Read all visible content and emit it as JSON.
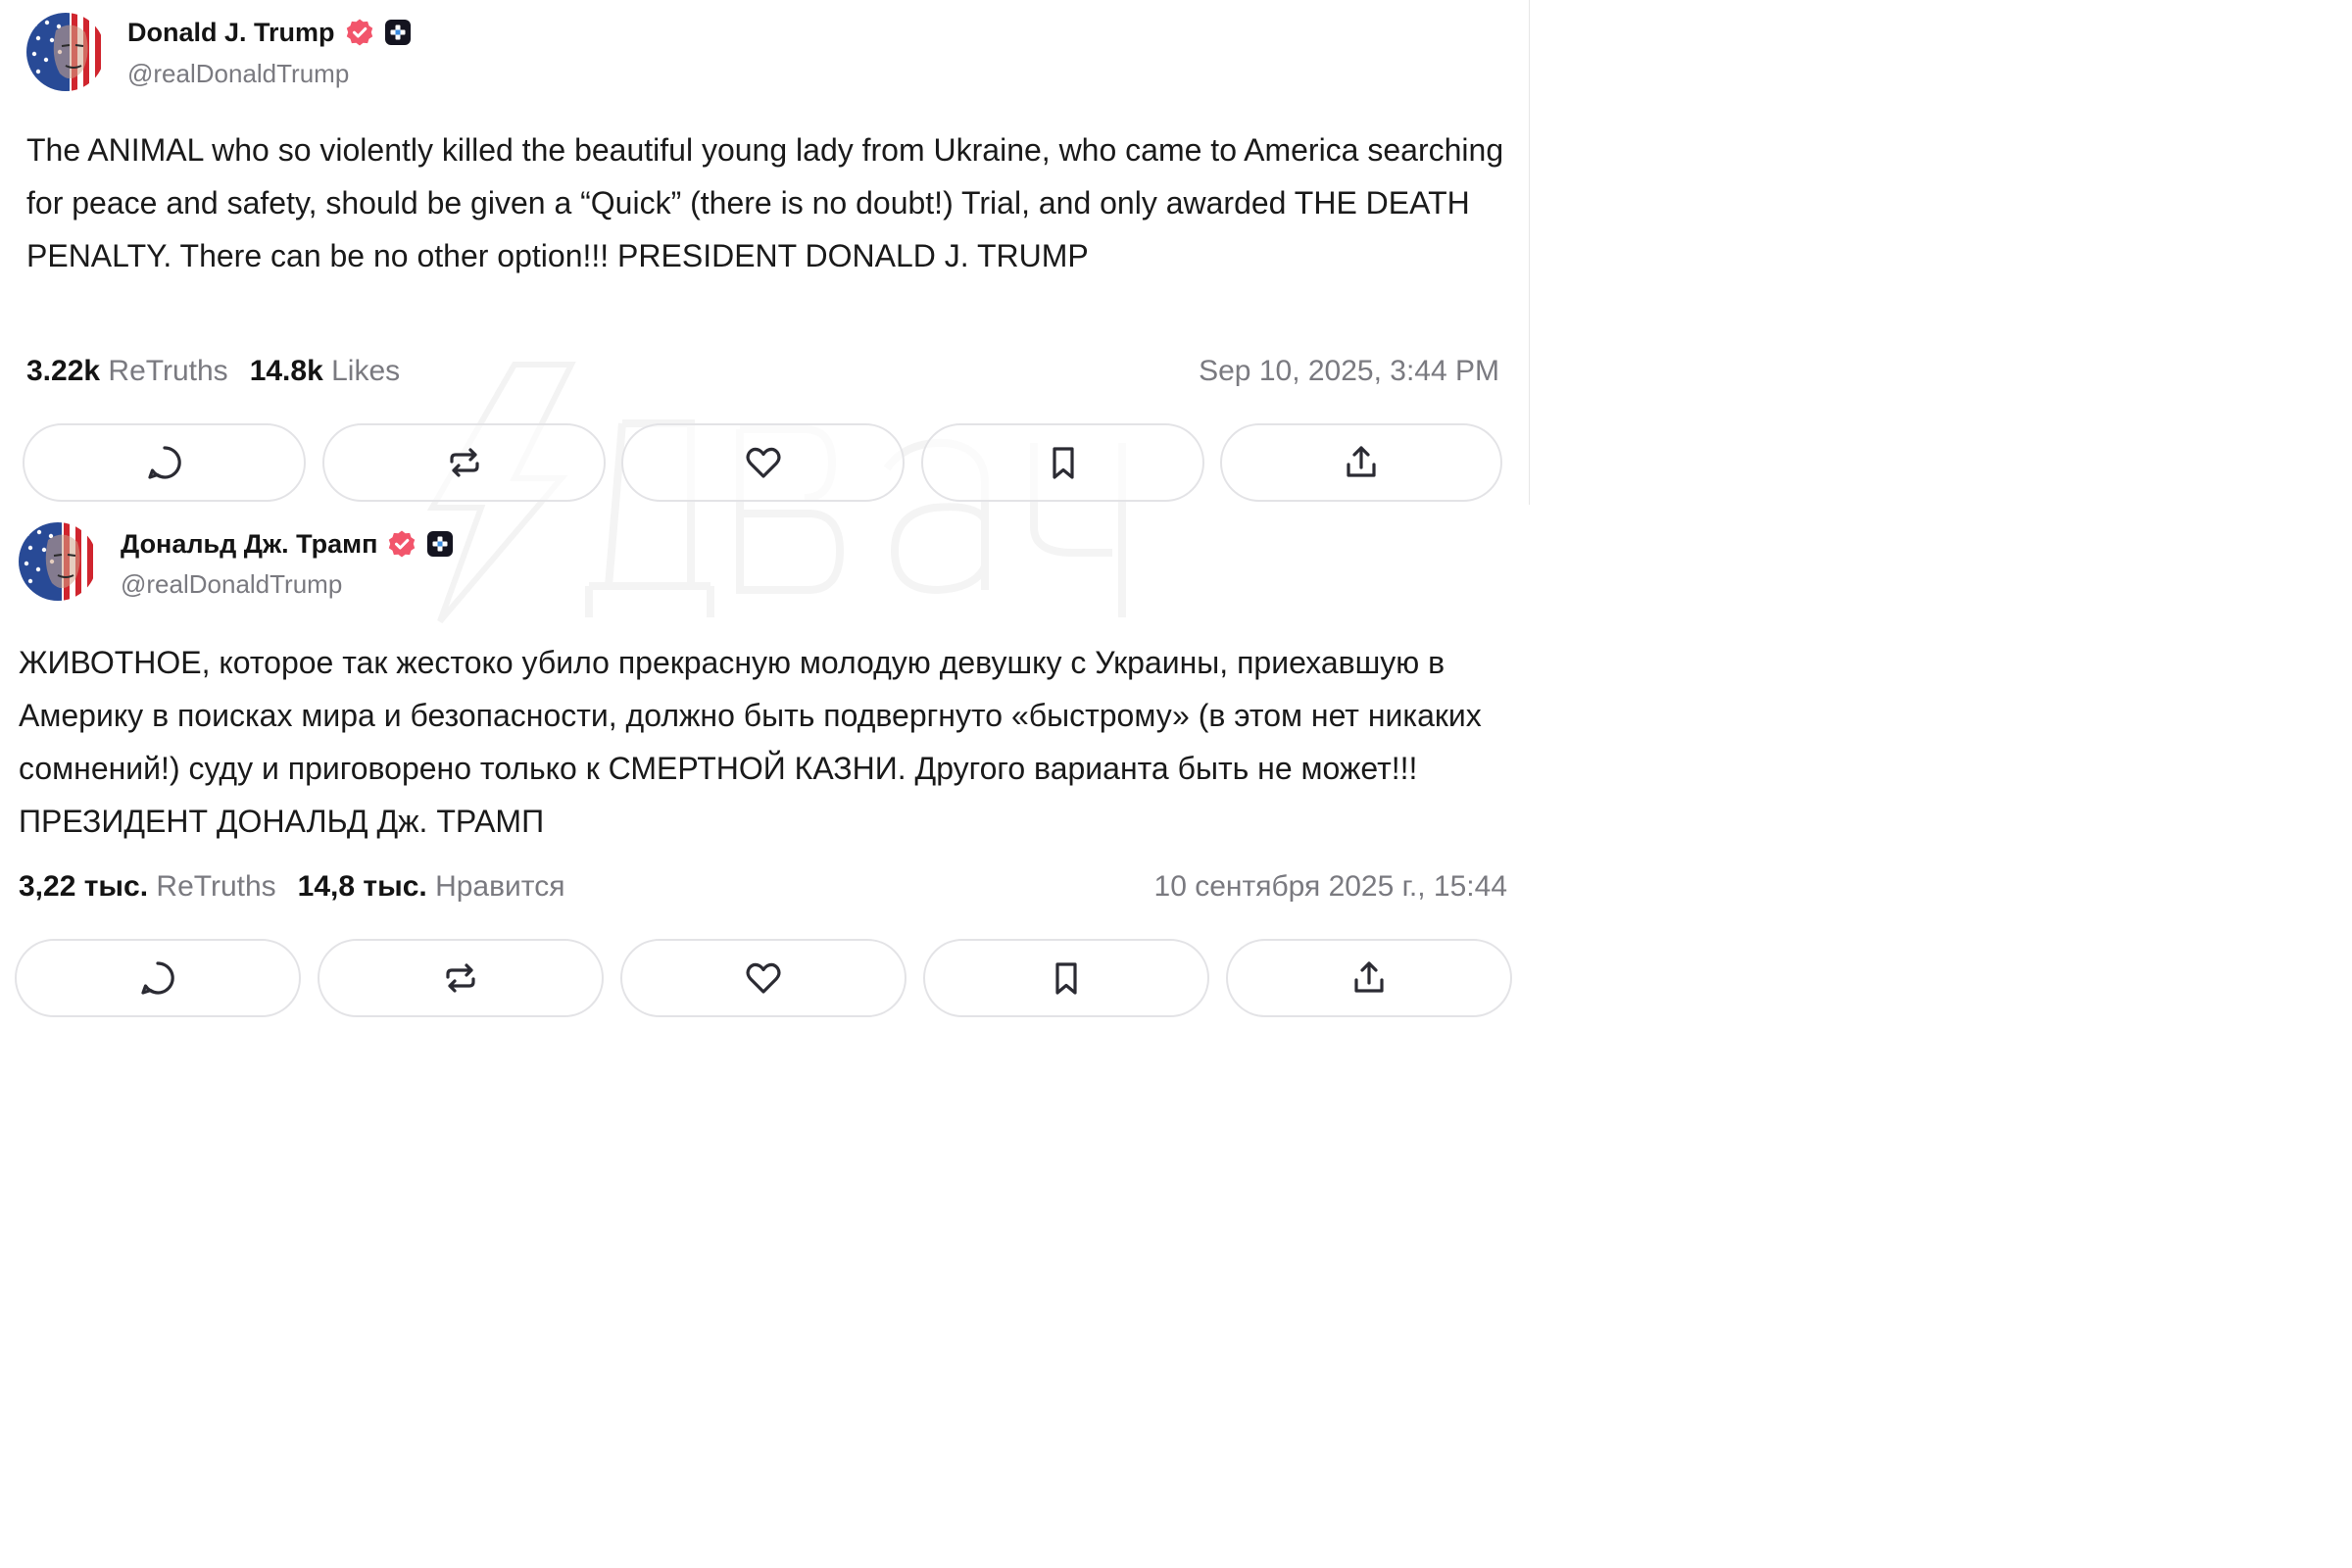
{
  "watermark_color": "#f6f6f6",
  "posts": [
    {
      "display_name": "Donald J. Trump",
      "handle": "@realDonaldTrump",
      "verified_badge_color": "#f2556b",
      "avatar_icon": "avatar-american-flag-portrait",
      "text": "The ANIMAL who so violently killed the beautiful young lady from Ukraine, who came to America searching for peace and safety, should be given a “Quick” (there is no doubt!) Trial, and only awarded THE DEATH PENALTY. There can be no other option!!! PRESIDENT DONALD J. TRUMP",
      "retruths_count": "3.22k",
      "retruths_label": "ReTruths",
      "likes_count": "14.8k",
      "likes_label": "Likes",
      "timestamp": "Sep 10, 2025, 3:44 PM",
      "actions": [
        "reply-icon",
        "retruth-icon",
        "heart-icon",
        "bookmark-icon",
        "share-icon"
      ]
    },
    {
      "display_name": "Дональд Дж. Трамп",
      "handle": "@realDonaldTrump",
      "verified_badge_color": "#f2556b",
      "avatar_icon": "avatar-american-flag-portrait",
      "text": "ЖИВОТНОЕ, которое так жестоко убило прекрасную молодую девушку с Украины, приехавшую в Америку в поисках мира и безопасности, должно быть подвергнуто «быстрому» (в этом нет никаких сомнений!) суду и приговорено только к СМЕРТНОЙ КАЗНИ. Другого варианта быть не может!!! ПРЕЗИДЕНТ ДОНАЛЬД Дж. ТРАМП",
      "retruths_count": "3,22 тыс.",
      "retruths_label": "ReTruths",
      "likes_count": "14,8 тыс.",
      "likes_label": "Нравится",
      "timestamp": "10 сентября 2025 г., 15:44",
      "actions": [
        "reply-icon",
        "retruth-icon",
        "heart-icon",
        "bookmark-icon",
        "share-icon"
      ]
    }
  ]
}
